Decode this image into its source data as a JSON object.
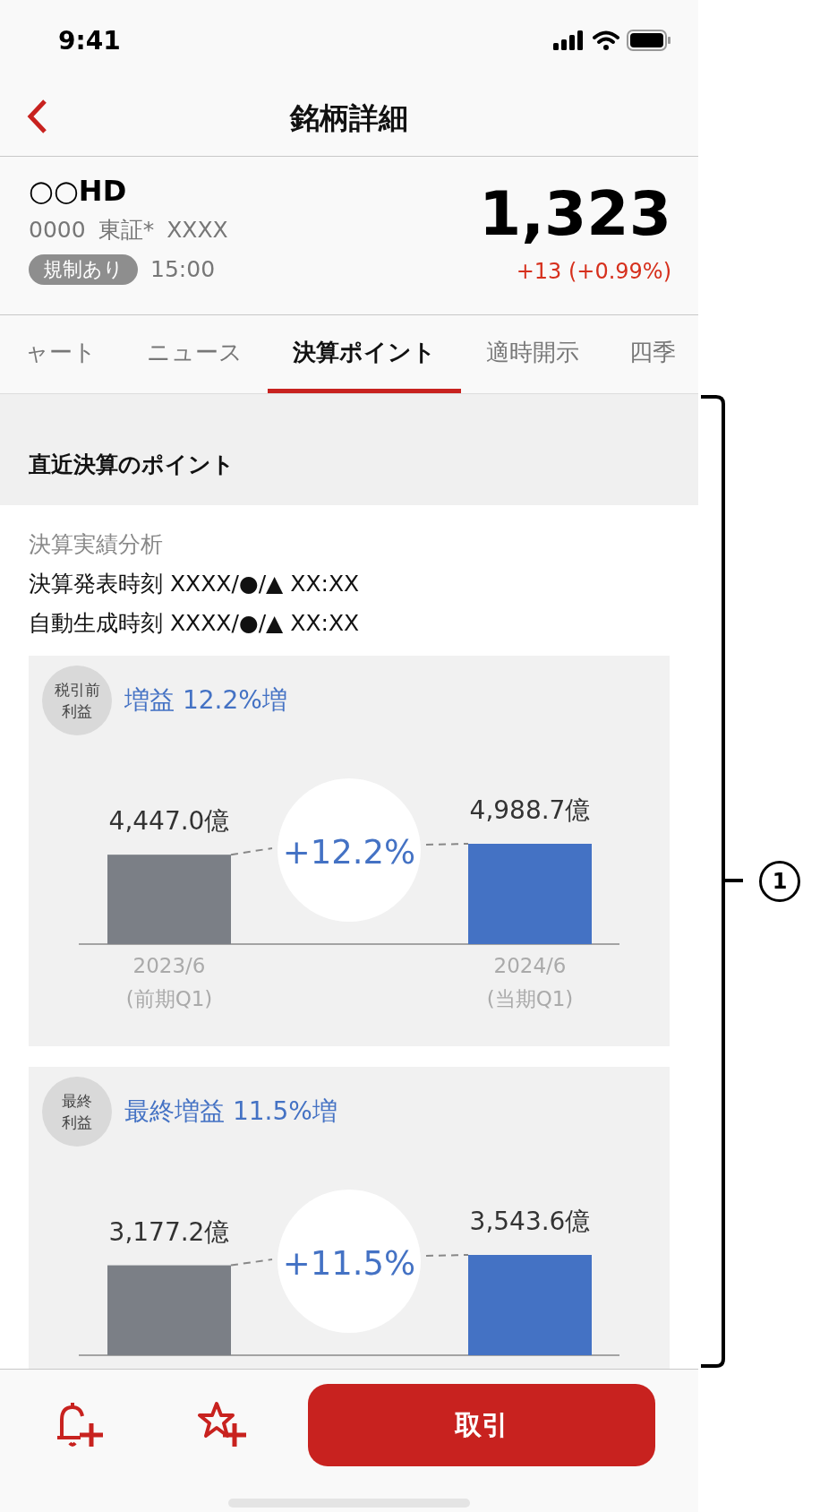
{
  "status_bar": {
    "time": "9:41"
  },
  "nav": {
    "title": "銘柄詳細"
  },
  "stock": {
    "name": "○○HD",
    "code": "0000",
    "market": "東証*",
    "ticker": "XXXX",
    "badge": "規制あり",
    "time": "15:00",
    "price": "1,323",
    "change": "+13 (+0.99%)"
  },
  "tabs": [
    {
      "label": "ャート",
      "selected": false
    },
    {
      "label": "ニュース",
      "selected": false
    },
    {
      "label": "決算ポイント",
      "selected": true
    },
    {
      "label": "適時開示",
      "selected": false
    },
    {
      "label": "四季",
      "selected": false
    }
  ],
  "section": {
    "title": "直近決算のポイント"
  },
  "analysis": {
    "heading": "決算実績分析",
    "lines": [
      "決算発表時刻 XXXX/●/▲ XX:XX",
      "自動生成時刻 XXXX/●/▲ XX:XX"
    ]
  },
  "cards": [
    {
      "badge_lines": [
        "税引前",
        "利益"
      ],
      "title": "増益 12.2%増",
      "change": "+12.2%",
      "chart_data": {
        "type": "bar",
        "categories": [
          "2023/6\n(前期Q1)",
          "2024/6\n(当期Q1)"
        ],
        "values": [
          4447.0,
          4988.7
        ],
        "value_labels": [
          "4,447.0億",
          "4,988.7億"
        ]
      }
    },
    {
      "badge_lines": [
        "最終",
        "利益"
      ],
      "title": "最終増益 11.5%増",
      "change": "+11.5%",
      "chart_data": {
        "type": "bar",
        "values": [
          3177.2,
          3543.6
        ],
        "value_labels": [
          "3,177.2億",
          "3,543.6億"
        ]
      }
    }
  ],
  "footer": {
    "trade_button": "取引"
  },
  "annotation": {
    "number": "1"
  }
}
